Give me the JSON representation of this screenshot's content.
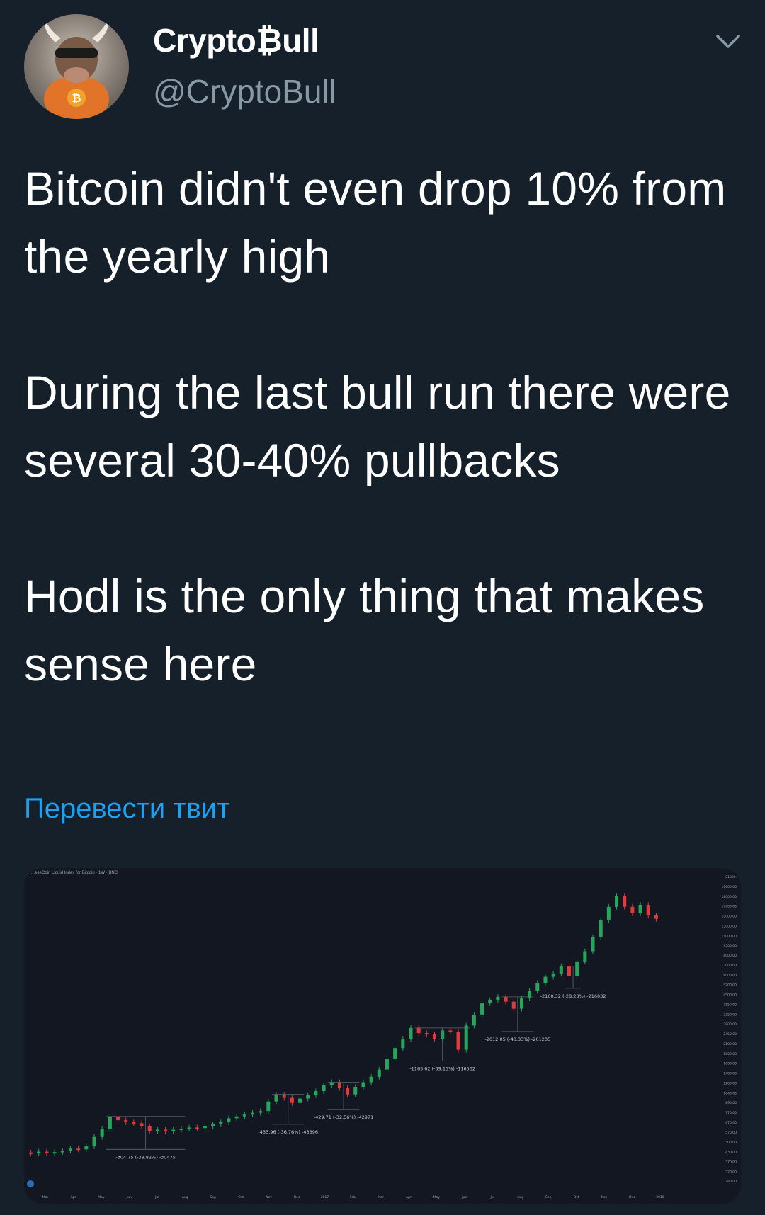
{
  "tweet": {
    "display_name": "Crypto₿ull",
    "handle": "@CryptoBull",
    "text": "Bitcoin didn't even drop 10% from the yearly high\n\nDuring the last bull run there were several 30-40% pullbacks\n\nHodl is the only thing that makes sense here",
    "translate_label": "Перевести твит",
    "menu_icon": "chevron-down-icon"
  },
  "colors": {
    "background": "#15202b",
    "text": "#ffffff",
    "secondary_text": "#8899a6",
    "link": "#1da1f2",
    "chart_bg": "#131722",
    "candle_up": "#26a65b",
    "candle_down": "#e03a3a"
  },
  "chart_data": {
    "type": "candlestick",
    "title": "...eeeCoin Liquid Index for Bitcoin · 1W · BNC",
    "x_tick_labels": [
      "Mar",
      "Apr",
      "May",
      "Jun",
      "Jul",
      "Aug",
      "Sep",
      "Oct",
      "Nov",
      "Dec",
      "2017",
      "Feb",
      "Mar",
      "Apr",
      "May",
      "Jun",
      "Jul",
      "Aug",
      "Sep",
      "Oct",
      "Nov",
      "Dec",
      "2018"
    ],
    "y_tick_labels": [
      "21000.",
      "19000.00",
      "18000.00",
      "17000.00",
      "15000.00",
      "13000.00",
      "11000.00",
      "9500.00",
      "8000.00",
      "7000.00",
      "6000.00",
      "5200.00",
      "4500.00",
      "3850.00",
      "3350.00",
      "2900.00",
      "2450.00",
      "2100.00",
      "1800.00",
      "1600.00",
      "1400.00",
      "1200.00",
      "1040.00",
      "890.00",
      "770.00",
      "670.00",
      "570.00",
      "500.00",
      "430.00",
      "370.00",
      "320.00",
      "280.00"
    ],
    "pullback_annotations": [
      "-304.75 (-38.82%) -30475",
      "-433.96 (-36.76%) -43396",
      "-429.71 (-32.56%) -42971",
      "-1165.62 (-39.15%) -116562",
      "-2012.05 (-40.33%) -201205",
      "-2160.32 (-28.23%) -216032"
    ],
    "candles": [
      {
        "o": 420,
        "c": 415
      },
      {
        "o": 415,
        "c": 425
      },
      {
        "o": 425,
        "c": 418
      },
      {
        "o": 418,
        "c": 422
      },
      {
        "o": 422,
        "c": 430
      },
      {
        "o": 430,
        "c": 445
      },
      {
        "o": 445,
        "c": 440
      },
      {
        "o": 440,
        "c": 460
      },
      {
        "o": 460,
        "c": 530
      },
      {
        "o": 530,
        "c": 600
      },
      {
        "o": 600,
        "c": 720
      },
      {
        "o": 720,
        "c": 680
      },
      {
        "o": 680,
        "c": 660
      },
      {
        "o": 660,
        "c": 650
      },
      {
        "o": 650,
        "c": 620
      },
      {
        "o": 620,
        "c": 580
      },
      {
        "o": 580,
        "c": 590
      },
      {
        "o": 590,
        "c": 575
      },
      {
        "o": 575,
        "c": 590
      },
      {
        "o": 590,
        "c": 600
      },
      {
        "o": 600,
        "c": 610
      },
      {
        "o": 610,
        "c": 605
      },
      {
        "o": 605,
        "c": 620
      },
      {
        "o": 620,
        "c": 640
      },
      {
        "o": 640,
        "c": 660
      },
      {
        "o": 660,
        "c": 700
      },
      {
        "o": 700,
        "c": 720
      },
      {
        "o": 720,
        "c": 740
      },
      {
        "o": 740,
        "c": 760
      },
      {
        "o": 760,
        "c": 780
      },
      {
        "o": 780,
        "c": 900
      },
      {
        "o": 900,
        "c": 1000
      },
      {
        "o": 1000,
        "c": 950
      },
      {
        "o": 950,
        "c": 880
      },
      {
        "o": 880,
        "c": 940
      },
      {
        "o": 940,
        "c": 990
      },
      {
        "o": 990,
        "c": 1050
      },
      {
        "o": 1050,
        "c": 1150
      },
      {
        "o": 1150,
        "c": 1200
      },
      {
        "o": 1200,
        "c": 1100
      },
      {
        "o": 1100,
        "c": 1000
      },
      {
        "o": 1000,
        "c": 1120
      },
      {
        "o": 1120,
        "c": 1200
      },
      {
        "o": 1200,
        "c": 1300
      },
      {
        "o": 1300,
        "c": 1450
      },
      {
        "o": 1450,
        "c": 1700
      },
      {
        "o": 1700,
        "c": 2000
      },
      {
        "o": 2000,
        "c": 2300
      },
      {
        "o": 2300,
        "c": 2700
      },
      {
        "o": 2700,
        "c": 2500
      },
      {
        "o": 2500,
        "c": 2450
      },
      {
        "o": 2450,
        "c": 2300
      },
      {
        "o": 2300,
        "c": 2600
      },
      {
        "o": 2600,
        "c": 2550
      },
      {
        "o": 2550,
        "c": 1950
      },
      {
        "o": 1950,
        "c": 2800
      },
      {
        "o": 2800,
        "c": 3300
      },
      {
        "o": 3300,
        "c": 3900
      },
      {
        "o": 3900,
        "c": 4100
      },
      {
        "o": 4100,
        "c": 4300
      },
      {
        "o": 4300,
        "c": 4000
      },
      {
        "o": 4000,
        "c": 3600
      },
      {
        "o": 3600,
        "c": 4200
      },
      {
        "o": 4200,
        "c": 4700
      },
      {
        "o": 4700,
        "c": 5300
      },
      {
        "o": 5300,
        "c": 5800
      },
      {
        "o": 5800,
        "c": 6100
      },
      {
        "o": 6100,
        "c": 6800
      },
      {
        "o": 6800,
        "c": 5900
      },
      {
        "o": 5900,
        "c": 7300
      },
      {
        "o": 7300,
        "c": 8500
      },
      {
        "o": 8500,
        "c": 10500
      },
      {
        "o": 10500,
        "c": 13500
      },
      {
        "o": 13500,
        "c": 16500
      },
      {
        "o": 16500,
        "c": 19500
      },
      {
        "o": 19500,
        "c": 16500
      },
      {
        "o": 16500,
        "c": 15000
      },
      {
        "o": 15000,
        "c": 17000
      },
      {
        "o": 17000,
        "c": 14500
      },
      {
        "o": 14500,
        "c": 13800
      }
    ],
    "y_scale": "log",
    "ylim": [
      280,
      21000
    ],
    "grid": false,
    "legend": "none"
  }
}
